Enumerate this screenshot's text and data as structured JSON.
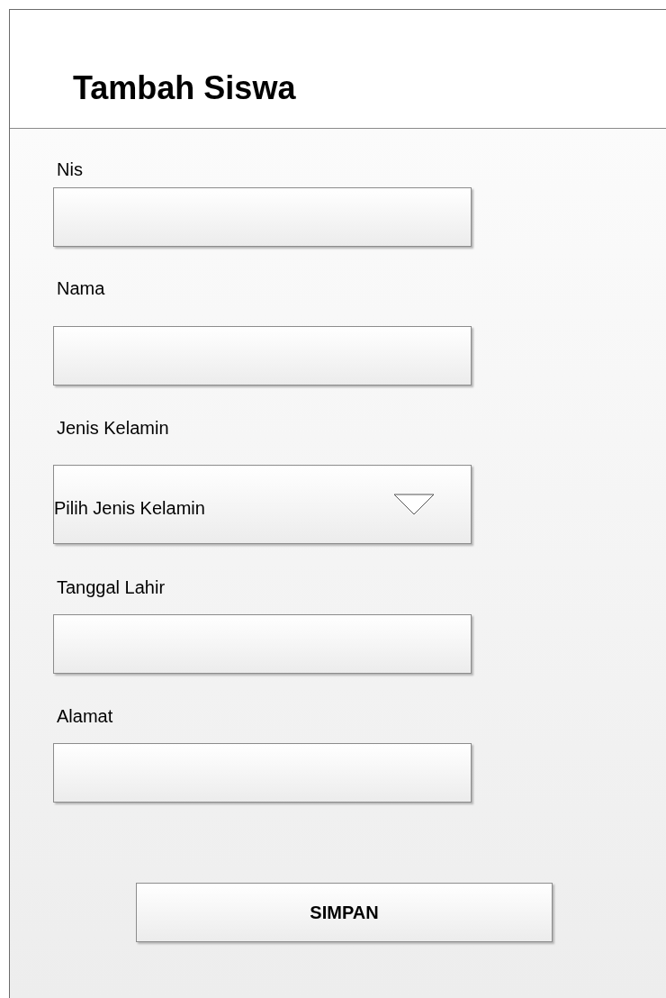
{
  "title": "Tambah Siswa",
  "fields": [
    {
      "kind": "input",
      "label": "Nis"
    },
    {
      "kind": "input",
      "label": "Nama"
    },
    {
      "kind": "select",
      "label": "Jenis Kelamin",
      "value": "Pilih Jenis Kelamin"
    },
    {
      "kind": "input",
      "label": "Tanggal Lahir"
    },
    {
      "kind": "input",
      "label": "Alamat"
    }
  ],
  "button": "SIMPAN"
}
